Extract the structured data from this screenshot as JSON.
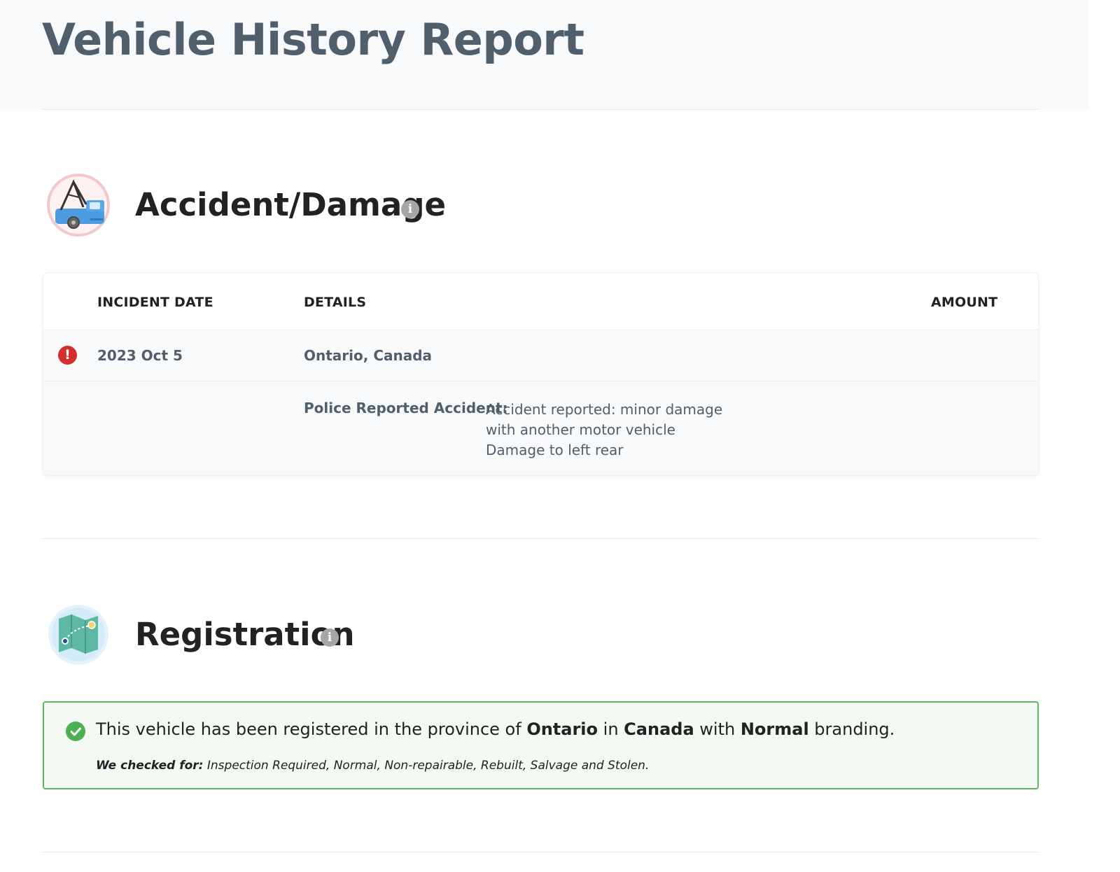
{
  "header": {
    "title": "Vehicle History Report"
  },
  "accident": {
    "title": "Accident/Damage",
    "info_icon": "info-icon",
    "section_icon": "tow-truck-icon",
    "columns": {
      "date": "INCIDENT DATE",
      "details": "DETAILS",
      "amount": "AMOUNT"
    },
    "rows": [
      {
        "status_icon": "alert-icon",
        "date": "2023 Oct 5",
        "location": "Ontario, Canada",
        "amount": "",
        "detail_label": "Police Reported Accident:",
        "detail_lines": [
          "Accident reported: minor damage",
          "with another motor vehicle",
          "Damage to left rear"
        ]
      }
    ]
  },
  "registration": {
    "title": "Registration",
    "info_icon": "info-icon",
    "section_icon": "map-icon",
    "status_icon": "check-circle-icon",
    "status_color": "#5cb85c",
    "sentence": {
      "p1": "This vehicle has been registered in the province of ",
      "province": "Ontario",
      "p2": " in ",
      "country": "Canada",
      "p3": " with ",
      "branding": "Normal",
      "p4": " branding."
    },
    "checked_label": "We checked for:",
    "checked_list": " Inspection Required, Normal, Non-repairable, Rebuilt, Salvage and Stolen."
  },
  "colors": {
    "title": "#515e6b",
    "alert": "#d32f2f",
    "success": "#4caf50"
  }
}
